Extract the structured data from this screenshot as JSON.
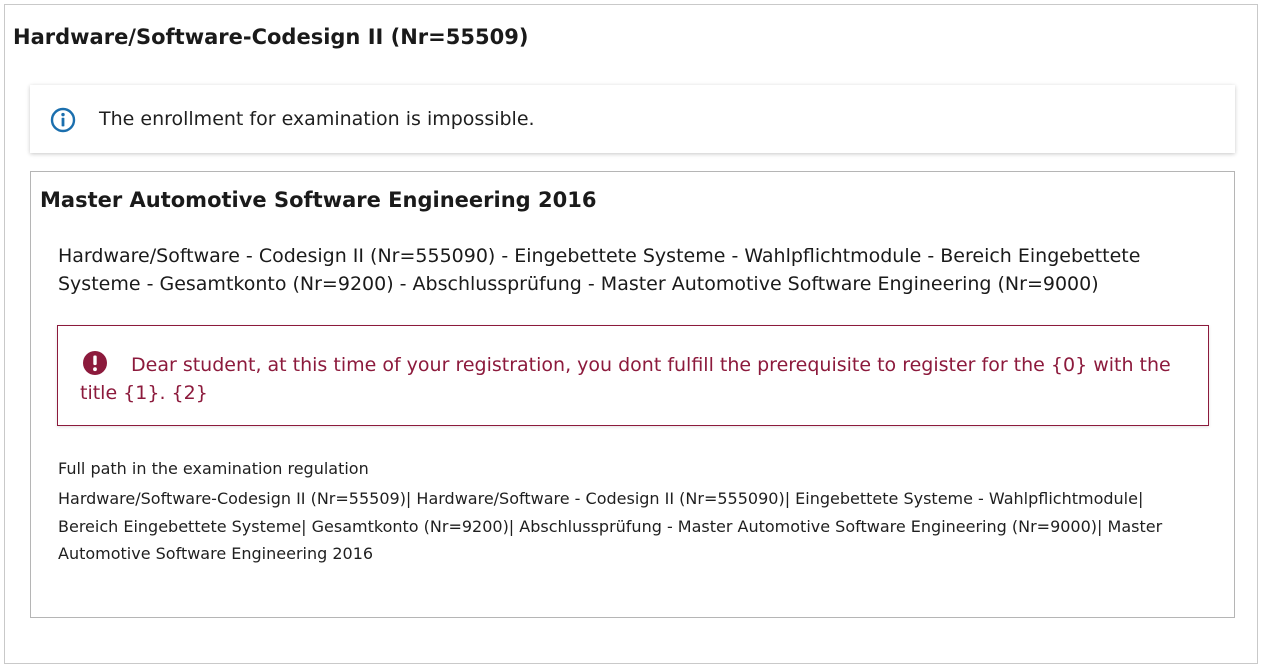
{
  "page": {
    "title": "Hardware/Software-Codesign II (Nr=55509)"
  },
  "info_message": {
    "icon": "info-circle-icon",
    "text": "The enrollment for examination is impossible.",
    "color": "#1b6fae"
  },
  "program": {
    "title": "Master Automotive Software Engineering 2016",
    "module_path": "Hardware/Software - Codesign II (Nr=555090) - Eingebettete Systeme - Wahlpflichtmodule - Bereich Eingebettete Systeme - Gesamtkonto (Nr=9200) - Abschlussprüfung - Master Automotive Software Engineering (Nr=9000)",
    "error": {
      "icon": "exclamation-circle-icon",
      "text": "Dear student, at this time of your registration, you dont fulfill the prerequisite to register for the {0} with the title {1}. {2}",
      "color": "#8c1a3c"
    },
    "full_path_label": "Full path in the examination regulation",
    "full_path_value": "Hardware/Software-Codesign II (Nr=55509)| Hardware/Software - Codesign II (Nr=555090)| Eingebettete Systeme - Wahlpflichtmodule| Bereich Eingebettete Systeme| Gesamtkonto (Nr=9200)| Abschlussprüfung - Master Automotive Software Engineering (Nr=9000)| Master Automotive Software Engineering 2016"
  }
}
